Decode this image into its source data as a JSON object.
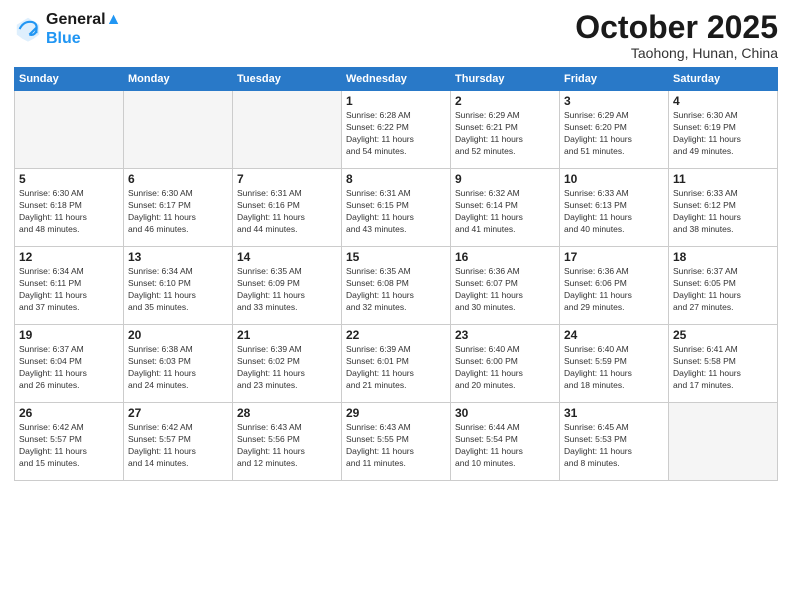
{
  "header": {
    "logo_line1": "General",
    "logo_line2": "Blue",
    "month": "October 2025",
    "location": "Taohong, Hunan, China"
  },
  "days_of_week": [
    "Sunday",
    "Monday",
    "Tuesday",
    "Wednesday",
    "Thursday",
    "Friday",
    "Saturday"
  ],
  "weeks": [
    [
      {
        "day": "",
        "info": ""
      },
      {
        "day": "",
        "info": ""
      },
      {
        "day": "",
        "info": ""
      },
      {
        "day": "1",
        "info": "Sunrise: 6:28 AM\nSunset: 6:22 PM\nDaylight: 11 hours\nand 54 minutes."
      },
      {
        "day": "2",
        "info": "Sunrise: 6:29 AM\nSunset: 6:21 PM\nDaylight: 11 hours\nand 52 minutes."
      },
      {
        "day": "3",
        "info": "Sunrise: 6:29 AM\nSunset: 6:20 PM\nDaylight: 11 hours\nand 51 minutes."
      },
      {
        "day": "4",
        "info": "Sunrise: 6:30 AM\nSunset: 6:19 PM\nDaylight: 11 hours\nand 49 minutes."
      }
    ],
    [
      {
        "day": "5",
        "info": "Sunrise: 6:30 AM\nSunset: 6:18 PM\nDaylight: 11 hours\nand 48 minutes."
      },
      {
        "day": "6",
        "info": "Sunrise: 6:30 AM\nSunset: 6:17 PM\nDaylight: 11 hours\nand 46 minutes."
      },
      {
        "day": "7",
        "info": "Sunrise: 6:31 AM\nSunset: 6:16 PM\nDaylight: 11 hours\nand 44 minutes."
      },
      {
        "day": "8",
        "info": "Sunrise: 6:31 AM\nSunset: 6:15 PM\nDaylight: 11 hours\nand 43 minutes."
      },
      {
        "day": "9",
        "info": "Sunrise: 6:32 AM\nSunset: 6:14 PM\nDaylight: 11 hours\nand 41 minutes."
      },
      {
        "day": "10",
        "info": "Sunrise: 6:33 AM\nSunset: 6:13 PM\nDaylight: 11 hours\nand 40 minutes."
      },
      {
        "day": "11",
        "info": "Sunrise: 6:33 AM\nSunset: 6:12 PM\nDaylight: 11 hours\nand 38 minutes."
      }
    ],
    [
      {
        "day": "12",
        "info": "Sunrise: 6:34 AM\nSunset: 6:11 PM\nDaylight: 11 hours\nand 37 minutes."
      },
      {
        "day": "13",
        "info": "Sunrise: 6:34 AM\nSunset: 6:10 PM\nDaylight: 11 hours\nand 35 minutes."
      },
      {
        "day": "14",
        "info": "Sunrise: 6:35 AM\nSunset: 6:09 PM\nDaylight: 11 hours\nand 33 minutes."
      },
      {
        "day": "15",
        "info": "Sunrise: 6:35 AM\nSunset: 6:08 PM\nDaylight: 11 hours\nand 32 minutes."
      },
      {
        "day": "16",
        "info": "Sunrise: 6:36 AM\nSunset: 6:07 PM\nDaylight: 11 hours\nand 30 minutes."
      },
      {
        "day": "17",
        "info": "Sunrise: 6:36 AM\nSunset: 6:06 PM\nDaylight: 11 hours\nand 29 minutes."
      },
      {
        "day": "18",
        "info": "Sunrise: 6:37 AM\nSunset: 6:05 PM\nDaylight: 11 hours\nand 27 minutes."
      }
    ],
    [
      {
        "day": "19",
        "info": "Sunrise: 6:37 AM\nSunset: 6:04 PM\nDaylight: 11 hours\nand 26 minutes."
      },
      {
        "day": "20",
        "info": "Sunrise: 6:38 AM\nSunset: 6:03 PM\nDaylight: 11 hours\nand 24 minutes."
      },
      {
        "day": "21",
        "info": "Sunrise: 6:39 AM\nSunset: 6:02 PM\nDaylight: 11 hours\nand 23 minutes."
      },
      {
        "day": "22",
        "info": "Sunrise: 6:39 AM\nSunset: 6:01 PM\nDaylight: 11 hours\nand 21 minutes."
      },
      {
        "day": "23",
        "info": "Sunrise: 6:40 AM\nSunset: 6:00 PM\nDaylight: 11 hours\nand 20 minutes."
      },
      {
        "day": "24",
        "info": "Sunrise: 6:40 AM\nSunset: 5:59 PM\nDaylight: 11 hours\nand 18 minutes."
      },
      {
        "day": "25",
        "info": "Sunrise: 6:41 AM\nSunset: 5:58 PM\nDaylight: 11 hours\nand 17 minutes."
      }
    ],
    [
      {
        "day": "26",
        "info": "Sunrise: 6:42 AM\nSunset: 5:57 PM\nDaylight: 11 hours\nand 15 minutes."
      },
      {
        "day": "27",
        "info": "Sunrise: 6:42 AM\nSunset: 5:57 PM\nDaylight: 11 hours\nand 14 minutes."
      },
      {
        "day": "28",
        "info": "Sunrise: 6:43 AM\nSunset: 5:56 PM\nDaylight: 11 hours\nand 12 minutes."
      },
      {
        "day": "29",
        "info": "Sunrise: 6:43 AM\nSunset: 5:55 PM\nDaylight: 11 hours\nand 11 minutes."
      },
      {
        "day": "30",
        "info": "Sunrise: 6:44 AM\nSunset: 5:54 PM\nDaylight: 11 hours\nand 10 minutes."
      },
      {
        "day": "31",
        "info": "Sunrise: 6:45 AM\nSunset: 5:53 PM\nDaylight: 11 hours\nand 8 minutes."
      },
      {
        "day": "",
        "info": ""
      }
    ]
  ]
}
